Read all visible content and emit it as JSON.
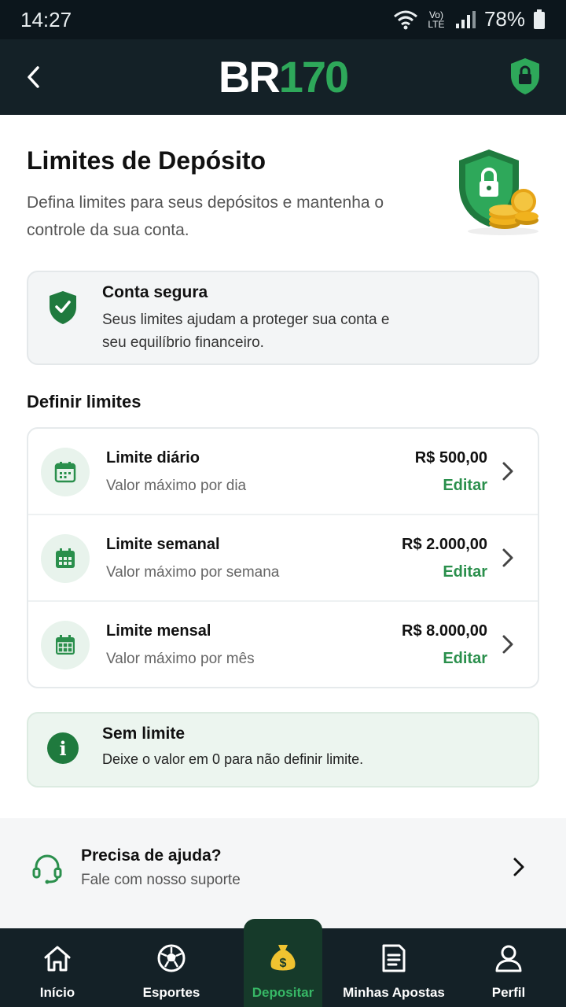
{
  "status_bar": {
    "time": "14:27",
    "network": "Vo) LTE",
    "battery": "78%"
  },
  "header": {
    "logo_letters": "BR",
    "logo_number": "170",
    "back_icon": "chevron-left-icon",
    "lock_icon": "shield-lock-icon"
  },
  "page": {
    "title": "Limites de Depósito",
    "description": "Defina limites para seus depósitos e mantenha o controle da sua conta."
  },
  "secure_notice": {
    "title": "Conta segura",
    "text": "Seus limites ajudam a proteger sua conta e seu equilíbrio financeiro."
  },
  "limits": {
    "section_title": "Definir limites",
    "items": [
      {
        "title": "Limite diário",
        "subtitle": "Valor máximo por dia",
        "value": "R$ 500,00",
        "edit": "Editar"
      },
      {
        "title": "Limite semanal",
        "subtitle": "Valor máximo por semana",
        "value": "R$ 2.000,00",
        "edit": "Editar"
      },
      {
        "title": "Limite mensal",
        "subtitle": "Valor máximo por mês",
        "value": "R$ 8.000,00",
        "edit": "Editar"
      }
    ]
  },
  "no_limit": {
    "icon_glyph": "i",
    "title": "Sem limite",
    "text": "Deixe o valor em 0 para não definir limite."
  },
  "help": {
    "title": "Precisa de ajuda?",
    "subtitle": "Fale com nosso suporte"
  },
  "bottom_nav": {
    "items": [
      {
        "label": "Início",
        "icon": "home-icon"
      },
      {
        "label": "Esportes",
        "icon": "soccer-ball-icon"
      },
      {
        "label": "Depositar",
        "icon": "money-bag-icon",
        "active": true
      },
      {
        "label": "Minhas Apostas",
        "icon": "ticket-icon"
      },
      {
        "label": "Perfil",
        "icon": "user-icon"
      }
    ]
  },
  "colors": {
    "header_bg": "#142127",
    "brand_green": "#2ea85a",
    "edit_green": "#2a8f4c",
    "active_nav_bg": "#163a2a"
  }
}
